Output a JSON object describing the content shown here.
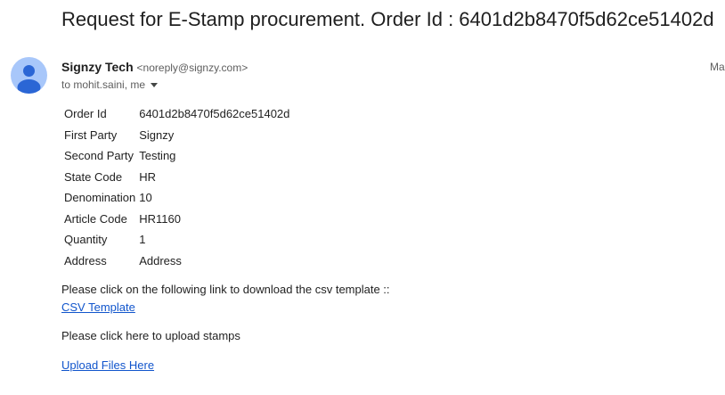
{
  "email": {
    "subject": "Request for E-Stamp procurement. Order Id : 6401d2b8470f5d62ce51402d",
    "sender": {
      "name": "Signzy Tech",
      "email": "<noreply@signzy.com>"
    },
    "date": "Ma",
    "recipients": "to mohit.saini, me",
    "avatar_color": "#a8c7fa",
    "avatar_figure_color": "#2b66d5",
    "details": [
      {
        "label": "Order Id",
        "value": "6401d2b8470f5d62ce51402d"
      },
      {
        "label": "First Party",
        "value": "Signzy"
      },
      {
        "label": "Second Party",
        "value": "Testing"
      },
      {
        "label": "State Code",
        "value": "HR"
      },
      {
        "label": "Denomination",
        "value": "10"
      },
      {
        "label": "Article Code",
        "value": "HR1160"
      },
      {
        "label": "Quantity",
        "value": "1"
      },
      {
        "label": "Address",
        "value": "Address"
      }
    ],
    "csv_prompt": "Please click on the following link to download the csv template ::",
    "csv_link": "CSV Template",
    "upload_prompt": "Please click here to upload stamps",
    "upload_link": "Upload Files Here",
    "link_color": "#1155cc"
  }
}
